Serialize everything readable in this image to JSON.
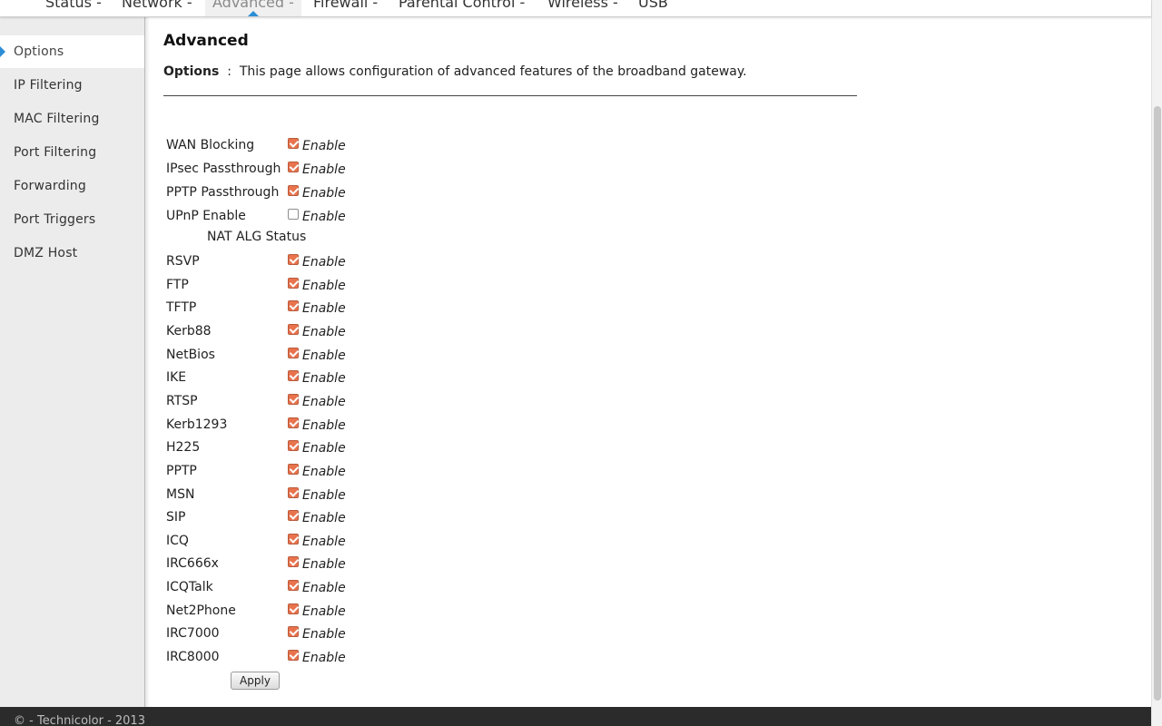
{
  "nav": {
    "items": [
      {
        "label": "Status -"
      },
      {
        "label": "Network -"
      },
      {
        "label": "Advanced -"
      },
      {
        "label": "Firewall -"
      },
      {
        "label": "Parental Control -"
      },
      {
        "label": "Wireless -"
      },
      {
        "label": "USB"
      }
    ],
    "active": "Advanced -",
    "accent_color": "#2c8ed6"
  },
  "sidebar": {
    "items": [
      {
        "label": "Options"
      },
      {
        "label": "IP Filtering"
      },
      {
        "label": "MAC Filtering"
      },
      {
        "label": "Port Filtering"
      },
      {
        "label": "Forwarding"
      },
      {
        "label": "Port Triggers"
      },
      {
        "label": "DMZ Host"
      }
    ],
    "active": "Options"
  },
  "page": {
    "title": "Advanced",
    "desc_label": "Options",
    "desc_sep": ":",
    "desc_text": "This page allows configuration of advanced features of the broadband gateway."
  },
  "options": [
    {
      "label": "WAN Blocking",
      "enabled": true,
      "text": "Enable"
    },
    {
      "label": "IPsec Passthrough",
      "enabled": true,
      "text": "Enable"
    },
    {
      "label": "PPTP Passthrough",
      "enabled": true,
      "text": "Enable"
    },
    {
      "label": "UPnP Enable",
      "enabled": false,
      "text": "Enable"
    }
  ],
  "nat_alg": {
    "heading": "NAT ALG Status",
    "items": [
      {
        "label": "RSVP",
        "enabled": true,
        "text": "Enable"
      },
      {
        "label": "FTP",
        "enabled": true,
        "text": "Enable"
      },
      {
        "label": "TFTP",
        "enabled": true,
        "text": "Enable"
      },
      {
        "label": "Kerb88",
        "enabled": true,
        "text": "Enable"
      },
      {
        "label": "NetBios",
        "enabled": true,
        "text": "Enable"
      },
      {
        "label": "IKE",
        "enabled": true,
        "text": "Enable"
      },
      {
        "label": "RTSP",
        "enabled": true,
        "text": "Enable"
      },
      {
        "label": "Kerb1293",
        "enabled": true,
        "text": "Enable"
      },
      {
        "label": "H225",
        "enabled": true,
        "text": "Enable"
      },
      {
        "label": "PPTP",
        "enabled": true,
        "text": "Enable"
      },
      {
        "label": "MSN",
        "enabled": true,
        "text": "Enable"
      },
      {
        "label": "SIP",
        "enabled": true,
        "text": "Enable"
      },
      {
        "label": "ICQ",
        "enabled": true,
        "text": "Enable"
      },
      {
        "label": "IRC666x",
        "enabled": true,
        "text": "Enable"
      },
      {
        "label": "ICQTalk",
        "enabled": true,
        "text": "Enable"
      },
      {
        "label": "Net2Phone",
        "enabled": true,
        "text": "Enable"
      },
      {
        "label": "IRC7000",
        "enabled": true,
        "text": "Enable"
      },
      {
        "label": "IRC8000",
        "enabled": true,
        "text": "Enable"
      }
    ]
  },
  "apply_label": "Apply",
  "footer": {
    "text": "© - Technicolor - 2013"
  }
}
